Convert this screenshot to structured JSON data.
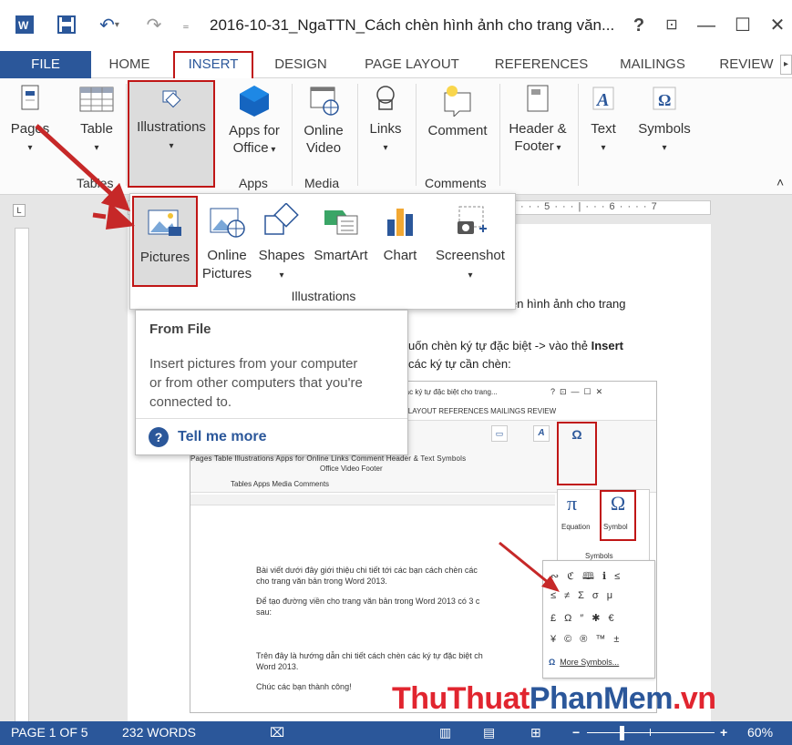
{
  "titlebar": {
    "title": "2016-10-31_NgaTTN_Cách chèn hình ảnh cho trang văn...",
    "help": "?",
    "restore_ribbon": "⊡",
    "minimize": "—",
    "maximize": "☐",
    "close": "✕"
  },
  "tabs": [
    "FILE",
    "HOME",
    "INSERT",
    "DESIGN",
    "PAGE LAYOUT",
    "REFERENCES",
    "MAILINGS",
    "REVIEW"
  ],
  "ribbon": {
    "pages": "Pages",
    "table": "Table",
    "illustrations": "Illustrations",
    "apps_for_office_1": "Apps for",
    "apps_for_office_2": "Office",
    "online_video_1": "Online",
    "online_video_2": "Video",
    "links": "Links",
    "comment": "Comment",
    "header_footer_1": "Header &",
    "header_footer_2": "Footer",
    "text": "Text",
    "symbols": "Symbols",
    "group_tables": "Tables",
    "group_apps": "Apps",
    "group_media": "Media",
    "group_comments": "Comments"
  },
  "illustrations_menu": {
    "pictures": "Pictures",
    "online_pictures_1": "Online",
    "online_pictures_2": "Pictures",
    "shapes": "Shapes",
    "smartart": "SmartArt",
    "chart": "Chart",
    "screenshot": "Screenshot",
    "group_label": "Illustrations"
  },
  "tooltip": {
    "heading": "From File",
    "body_1": "Insert pictures from your computer",
    "body_2": "or from other computers that you're",
    "body_3": "connected to.",
    "link": "Tell me more"
  },
  "document": {
    "line_1": "ền hình ảnh cho trang",
    "line_2a": "uốn chèn ký tự đặc biệt -> vào thẻ ",
    "line_2b": "Insert",
    "line_3": "các ký tự cần chèn:",
    "ruler_marks": "· · · 5 · · · | · · · 6 · · · · 7"
  },
  "inner_screenshot": {
    "title": "n các ký tự đặc biệt cho trang...",
    "tabs": "GE LAYOUT     REFERENCES     MAILINGS     REVIEW",
    "ribbon_labels": "Pages   Table   Illustrations   Apps for   Online   Links   Comment   Header &   Text   Symbols",
    "ribbon_labels_2": "Office    Video                        Footer",
    "group_labels": "Tables          Apps     Media           Comments",
    "equation": "Equation",
    "symbol": "Symbol",
    "symbols_group": "Symbols",
    "para_1a": "Bài viết dưới đây giới thiệu chi tiết tới các bạn cách chèn các",
    "para_1b": "cho trang văn bản trong Word 2013.",
    "para_2a": "Để tạo đường viền cho trang văn bản trong Word 2013 có 3 c",
    "para_2b": "sau:",
    "para_3a": "Trên đây là hướng dẫn chi tiết cách chèn các ký tự đặc biệt ch",
    "para_3b": "Word 2013.",
    "para_4": "Chúc các bạn thành công!",
    "grid_row_1": [
      "∾",
      "ℭ",
      "🕮",
      "ℹ",
      "≤"
    ],
    "grid_row_2": [
      "≤",
      "≠",
      "Σ",
      "σ",
      "μ"
    ],
    "grid_row_3": [
      "£",
      "Ω",
      "″",
      "✱",
      "€"
    ],
    "grid_row_4": [
      "¥",
      "©",
      "®",
      "™",
      "±"
    ],
    "more_symbols": "More Symbols..."
  },
  "statusbar": {
    "page": "PAGE 1 OF 5",
    "words": "232 WORDS",
    "zoom": "60%"
  },
  "watermark": {
    "part_1": "ThuThuat",
    "part_2": "PhanMem",
    "part_3": ".vn"
  },
  "colors": {
    "accent": "#2b579a",
    "highlight": "#c01616",
    "arrow": "#c62828"
  }
}
